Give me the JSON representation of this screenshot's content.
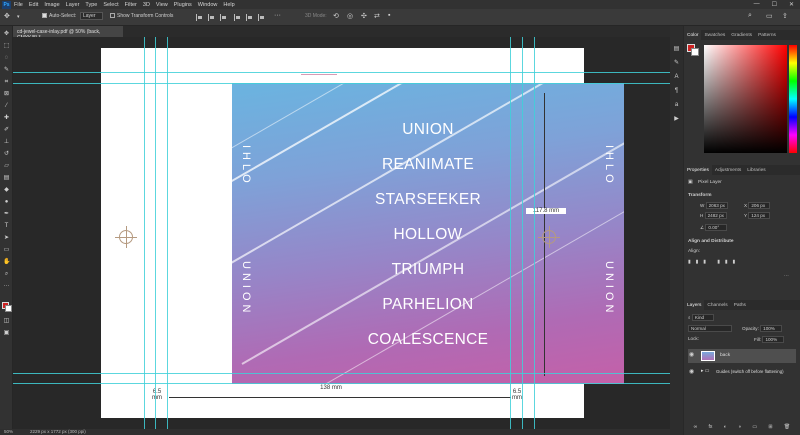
{
  "menubar": {
    "items": [
      "File",
      "Edit",
      "Image",
      "Layer",
      "Type",
      "Select",
      "Filter",
      "3D",
      "View",
      "Plugins",
      "Window",
      "Help"
    ],
    "window_controls": [
      "—",
      "☐",
      "✕"
    ]
  },
  "options": {
    "auto_select": "Auto-Select:",
    "auto_select_value": "Layer",
    "show_transform": "Show Transform Controls",
    "mode_3d": "3D Mode:"
  },
  "document": {
    "tab_title": "cd-jewel-case-inlay.pdf @ 50% (back, CMYK/8) *",
    "artwork": {
      "tracks": [
        "UNION",
        "REANIMATE",
        "STARSEEKER",
        "HOLLOW",
        "TRIUMPH",
        "PARHELION",
        "COALESCENCE"
      ],
      "spine_left_top": "IHLO",
      "spine_left_bottom": "UNION",
      "spine_right_top": "IHLO",
      "spine_right_bottom": "UNION"
    },
    "dimensions": {
      "height": "117.8 mm",
      "width": "138 mm",
      "left_spine": "6.5\nmm",
      "right_spine": "6.5\nmm"
    }
  },
  "status": {
    "zoom": "50%",
    "doc_size": "2229 px x 1772 px (300 ppi)"
  },
  "panels": {
    "color_tabs": [
      "Color",
      "Swatches",
      "Gradients",
      "Patterns"
    ],
    "properties_tabs": [
      "Properties",
      "Adjustments",
      "Libraries"
    ],
    "layer_type": "Pixel Layer",
    "transform_title": "Transform",
    "transform": {
      "w_label": "W",
      "w": "2063 px",
      "h_label": "H",
      "h": "2482 px",
      "x_label": "X",
      "x": "206 px",
      "y_label": "Y",
      "y": "124 px",
      "angle": "0.00°"
    },
    "align_title": "Align and Distribute",
    "align_label": "Align:",
    "layers_tabs": [
      "Layers",
      "Channels",
      "Paths"
    ],
    "kind": "Kind",
    "blend_mode": "Normal",
    "opacity_label": "Opacity:",
    "opacity": "100%",
    "lock_label": "Lock:",
    "fill_label": "Fill:",
    "fill": "100%",
    "layers": [
      {
        "name": "back",
        "selected": true
      },
      {
        "name": "Guides (switch off before flattening)",
        "selected": false
      }
    ]
  },
  "colors": {
    "accent_guide": "#3fd0d8",
    "foreground": "#cc2222",
    "background": "#ffffff"
  }
}
